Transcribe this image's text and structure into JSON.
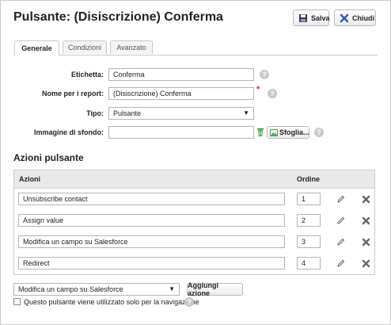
{
  "header": {
    "title": "Pulsante: (Disiscrizione) Conferma",
    "save_label": "Salva",
    "close_label": "Chiudi"
  },
  "tabs": [
    {
      "label": "Generale",
      "active": true
    },
    {
      "label": "Condizioni",
      "active": false
    },
    {
      "label": "Avanzato",
      "active": false
    }
  ],
  "form": {
    "etichetta_label": "Etichetta:",
    "etichetta_value": "Conferma",
    "report_label": "Nome per i report:",
    "report_value": "(Disiscrizione) Conferma",
    "tipo_label": "Tipo:",
    "tipo_value": "Pulsante",
    "sfondo_label": "Immagine di sfondo:",
    "sfondo_value": "",
    "browse_label": "Sfoglia..."
  },
  "actions": {
    "section_title": "Azioni pulsante",
    "col_actions": "Azioni",
    "col_order": "Ordine",
    "rows": [
      {
        "name": "Unsubscribe contact",
        "order": "1"
      },
      {
        "name": "Assign value",
        "order": "2"
      },
      {
        "name": "Modifica un campo su Salesforce",
        "order": "3"
      },
      {
        "name": "Redirect",
        "order": "4"
      }
    ]
  },
  "footer": {
    "add_select_value": "Modifica un campo su Salesforce",
    "add_button": "Aggiungi azione",
    "nav_checkbox_label": "Questo pulsante viene utilizzato solo per la navigazione",
    "nav_checked": false
  },
  "colors": {
    "required_star": "#d9292b",
    "help_icon": "#c9c9c9",
    "delete_icon": "#666666",
    "header_bg": "#e9e9e9"
  }
}
